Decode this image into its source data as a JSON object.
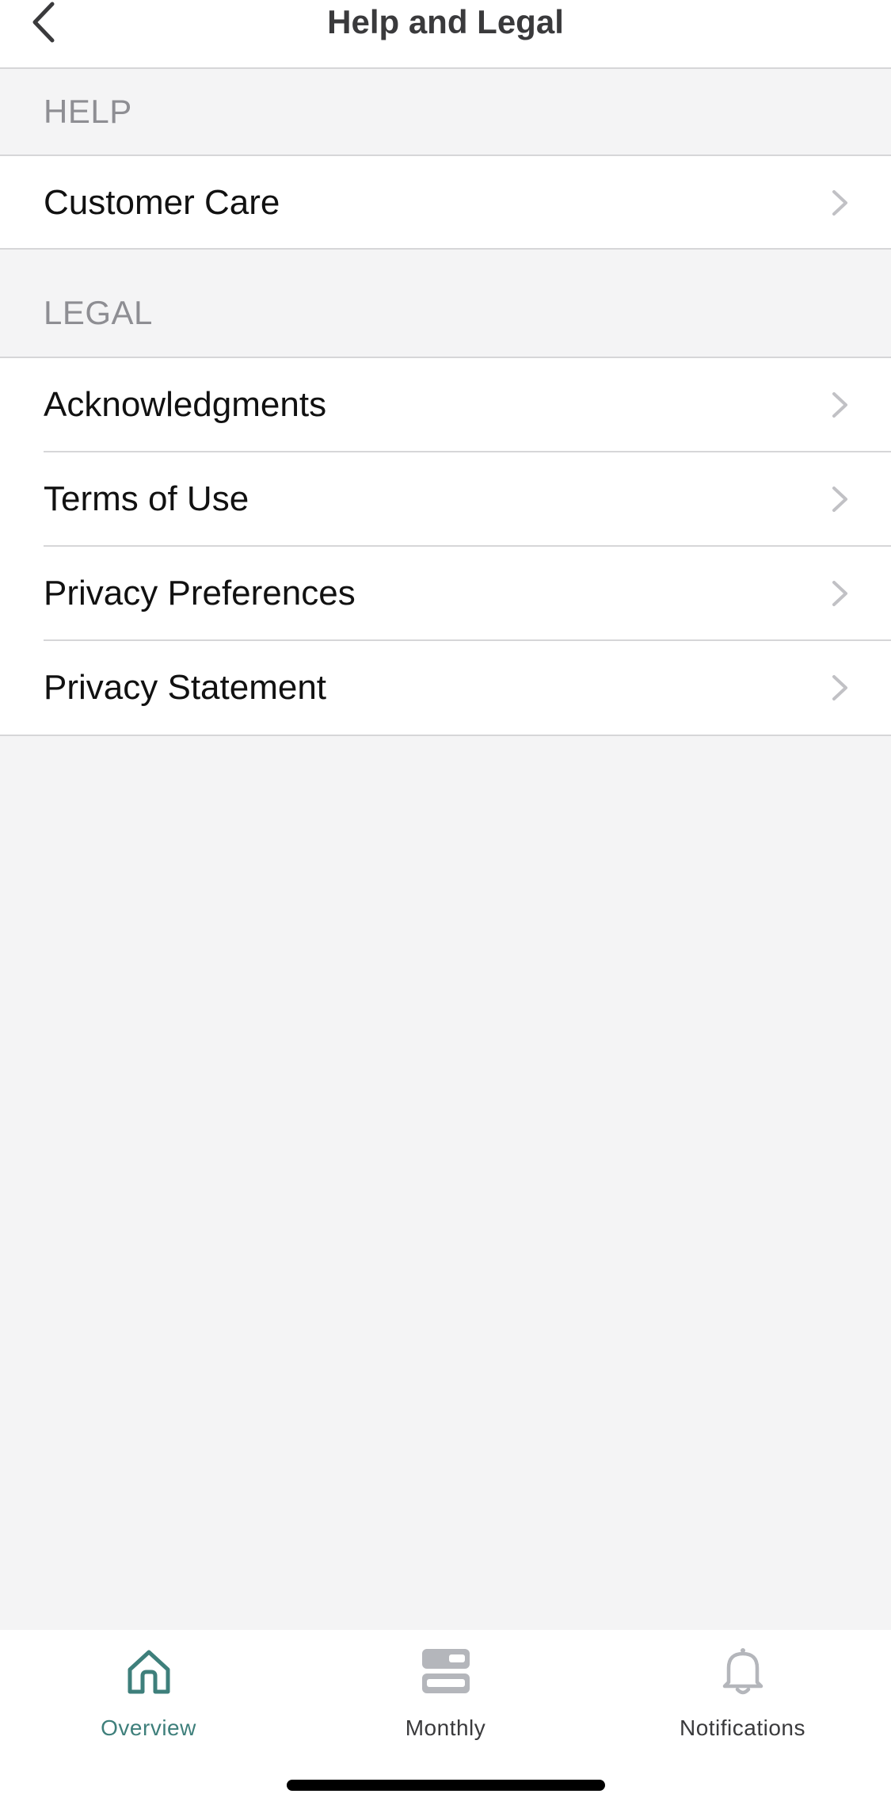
{
  "header": {
    "title": "Help and Legal"
  },
  "sections": {
    "help": {
      "title": "HELP",
      "items": [
        {
          "label": "Customer Care"
        }
      ]
    },
    "legal": {
      "title": "LEGAL",
      "items": [
        {
          "label": "Acknowledgments"
        },
        {
          "label": "Terms of Use"
        },
        {
          "label": "Privacy Preferences"
        },
        {
          "label": "Privacy Statement"
        }
      ]
    }
  },
  "tabbar": {
    "tabs": [
      {
        "label": "Overview",
        "icon": "home-icon",
        "active": true
      },
      {
        "label": "Monthly",
        "icon": "monthly-icon",
        "active": false
      },
      {
        "label": "Notifications",
        "icon": "bell-icon",
        "active": false
      }
    ]
  },
  "colors": {
    "accent": "#3e7f7b",
    "inactive_tab": "#3a3a3c",
    "inactive_icon": "#b4b6bb",
    "section_text": "#8e8e93",
    "background": "#f4f4f5",
    "separator": "#d6d6d8"
  }
}
